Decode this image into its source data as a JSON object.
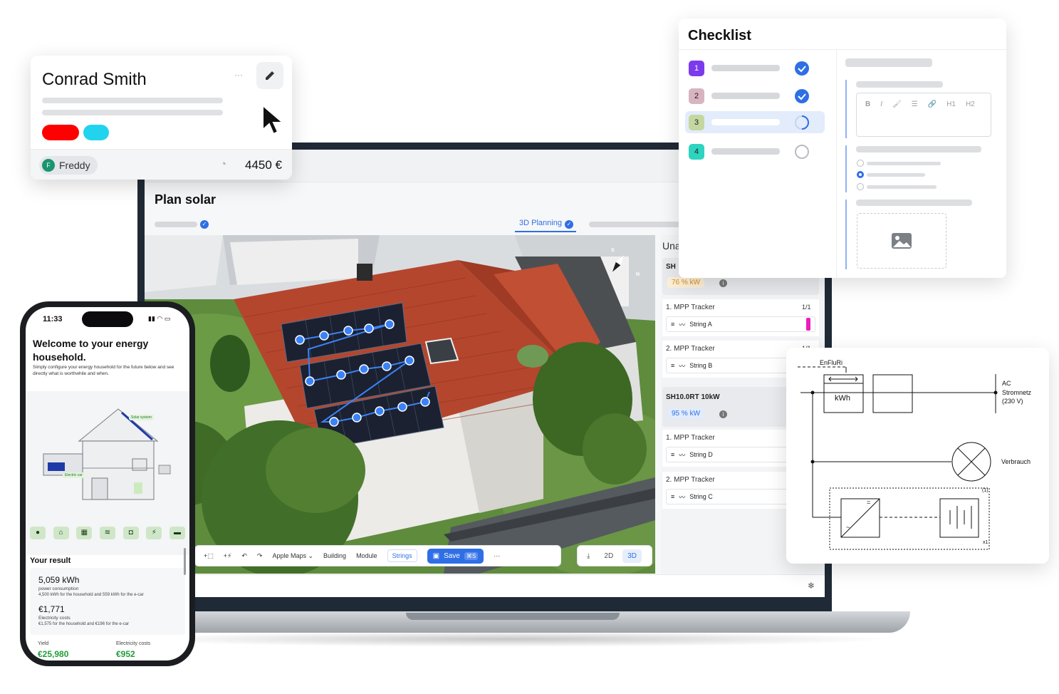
{
  "laptop": {
    "title": "Plan solar",
    "step_label": "3D Planning",
    "toolbar": {
      "apple_maps": "Apple Maps",
      "building": "Building",
      "module": "Module",
      "strings": "Strings",
      "save": "Save",
      "save_shortcut": "⌘S",
      "more": "···",
      "view_2d": "2D",
      "view_3d": "3D",
      "add_area": "+⬚",
      "add_power": "+⚡"
    },
    "panel": {
      "header": "Una",
      "inverter1": {
        "name": "SH",
        "pct": "76 % kW"
      },
      "inverter2": {
        "name": "SH10.0RT 10kW",
        "pct": "95 % kW"
      },
      "tracker1": "1. MPP Tracker",
      "tracker1_count": "1/1",
      "tracker2": "2. MPP Tracker",
      "tracker2_count": "1/1",
      "tracker3": "1. MPP Tracker",
      "tracker4": "2. MPP Tracker",
      "string_a": "String A",
      "string_b": "String B",
      "string_d": "String D",
      "string_c": "String C",
      "info": "i"
    },
    "compass": {
      "s": "S",
      "n": "N"
    }
  },
  "contact_card": {
    "name": "Conrad Smith",
    "user": "Freddy",
    "user_initial": "F",
    "amount": "4450 €",
    "more": "···",
    "colors": {
      "tag1": "#ff0000",
      "tag2": "#22d3ee"
    }
  },
  "checklist": {
    "title": "Checklist",
    "items": [
      {
        "number": "1",
        "color": "#7c3aed",
        "status": "done"
      },
      {
        "number": "2",
        "color": "#d8b4c0",
        "status": "done"
      },
      {
        "number": "3",
        "color": "#c4d7a0",
        "status": "in-progress"
      },
      {
        "number": "4",
        "color": "#2dd4bf",
        "status": "open"
      }
    ],
    "editor_tools": [
      "B",
      "I",
      "🖌",
      "☰",
      "🔗",
      "H1",
      "H2"
    ]
  },
  "diagram": {
    "label_enfluri": "EnFluRi",
    "meter": "kWh",
    "ac_label_1": "AC",
    "ac_label_2": "Stromnetz",
    "ac_label_3": "(230 V)",
    "consumer": "Verbrauch",
    "inv_eq": "=",
    "inv_ac": "~",
    "group_count": "(1)",
    "multiplier": "x1"
  },
  "phone": {
    "time": "11:33",
    "title": "Welcome to your energy household.",
    "subtitle": "Simply configure your energy household for the future below and see directly what is worthwhile and when.",
    "house_tag1": "Solar system",
    "house_tag2": "Electric car",
    "icons": [
      "pin-icon",
      "home-icon",
      "solar-icon",
      "heat-icon",
      "car-icon",
      "charger-icon",
      "battery-icon"
    ],
    "result_title": "Your result",
    "consumption_value": "5,059 kWh",
    "consumption_label": "power consumption",
    "consumption_detail": "4,500 kWh for the household and 559 kWh for the e-car",
    "cost_value": "€1,771",
    "cost_label": "Electricity costs",
    "cost_detail": "€1,575 for the household and €196 for the e-car",
    "yield_label": "Yield",
    "yield_value": "€25,980",
    "elec_label": "Electricity costs",
    "elec_value": "€952"
  }
}
